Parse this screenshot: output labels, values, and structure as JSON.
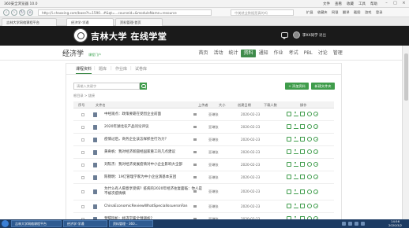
{
  "browser": {
    "title": "360安全浏览器 10.0",
    "menu": [
      "文件",
      "查看",
      "收藏",
      "工具",
      "帮助"
    ],
    "url": "http://i.chaoxing.com/base?t=1590...#&qt=...courseid=&moduleName=resource",
    "url_prefix": "http://",
    "url_domain": "chaoxing.com",
    "search_placeholder": "中美就业数据是真的吗",
    "bookmarks": [
      "扩展",
      "收藏夹",
      "网银",
      "翻译",
      "截图",
      "游戏",
      "登录"
    ],
    "tabs": [
      {
        "label": "吉林大学网络课程平台",
        "active": false
      },
      {
        "label": "经济学-学通",
        "active": true
      },
      {
        "label": "资料管理-首页",
        "active": false
      }
    ]
  },
  "header": {
    "brand": "吉林大学 在线学堂",
    "user_name": "李XX同学",
    "exit_label": "退出"
  },
  "course": {
    "name": "经济学",
    "sub": "课程门户"
  },
  "topnav": [
    {
      "label": "首页",
      "active": false
    },
    {
      "label": "活动",
      "active": false
    },
    {
      "label": "统计",
      "active": false
    },
    {
      "label": "资料",
      "active": true
    },
    {
      "label": "通知",
      "active": false
    },
    {
      "label": "作业",
      "active": false
    },
    {
      "label": "考试",
      "active": false
    },
    {
      "label": "PBL",
      "active": false
    },
    {
      "label": "讨论",
      "active": false
    },
    {
      "label": "管理",
      "active": false
    }
  ],
  "subtabs": [
    {
      "label": "课程资料",
      "active": true
    },
    {
      "label": "题库",
      "active": false
    },
    {
      "label": "作业库",
      "active": false
    },
    {
      "label": "试卷库",
      "active": false
    }
  ],
  "toolbar": {
    "search_placeholder": "请输入关键字",
    "add_label": "+ 添加资料",
    "new_folder_label": "新建文件夹"
  },
  "breadcrumb": "根目录 > 链接",
  "table": {
    "headers": [
      "序号",
      "文件名",
      "上传者",
      "大小",
      "创建日期",
      "下载人数",
      "操作"
    ],
    "rows": [
      {
        "name": "中经观点：政策要靠在受因企业前面",
        "uploader": "亚琳张",
        "date": "2020-02-23"
      },
      {
        "name": "2020年湖北农产品问论评议",
        "uploader": "亚琳张",
        "date": "2020-02-23"
      },
      {
        "name": "疫情过后，商务企业该怎样抓住行为力？",
        "uploader": "亚琳张",
        "date": "2020-02-23"
      },
      {
        "name": "黄奇帆：我对经济新圆经国家重工的几点建议",
        "uploader": "亚琳张",
        "date": "2020-02-23"
      },
      {
        "name": "刘陈杰：我对经济发展疫情对中小企业影响大全部",
        "uploader": "亚琳张",
        "date": "2020-02-23"
      },
      {
        "name": "陈锦明：19亿管理学家为中小企业演基本支团",
        "uploader": "亚琳张",
        "date": "2020-02-23"
      },
      {
        "name": "为什么有人愿意享受病？疫病的2020年经济往复面临：你人是不被次疫情横",
        "uploader": "亚琳张",
        "date": "2020-02-23",
        "tall": true
      },
      {
        "name": "ChinaEconomicReviewWhatSpecialIssueronFan",
        "uploader": "亚琳张",
        "date": "2020-02-23"
      },
      {
        "name": "梦甜玩析：经济学家全预测析？",
        "uploader": "亚琳张",
        "date": "2020-02-23"
      }
    ]
  },
  "taskbar": {
    "tasks": [
      "吉林大学网络课程平台",
      "经济学-学通",
      "资料管理 - 360..."
    ],
    "time": "14:56",
    "date": "2020/3/2"
  },
  "colors": {
    "accent": "#3f9c4b",
    "header_bg": "#1a1a1a",
    "taskbar_bg": "#1c3b63"
  }
}
